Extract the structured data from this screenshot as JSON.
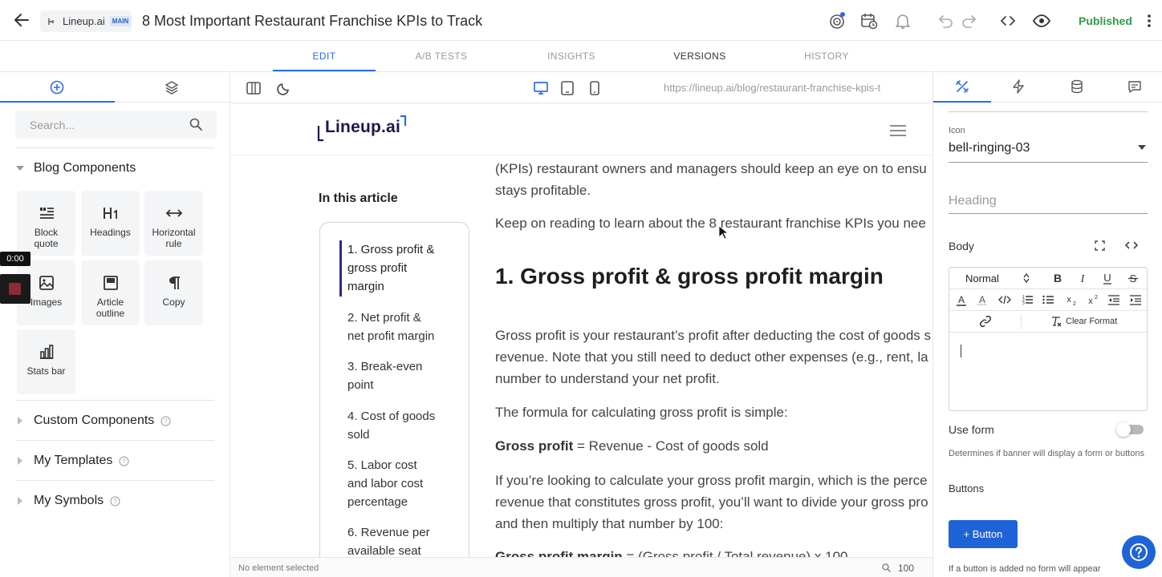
{
  "header": {
    "project_name": "Lineup.ai",
    "branch_badge": "MAIN",
    "doc_title": "8 Most Important Restaurant Franchise KPIs to Track",
    "status": "Published"
  },
  "tabs": [
    {
      "label": "EDIT"
    },
    {
      "label": "A/B TESTS"
    },
    {
      "label": "INSIGHTS"
    },
    {
      "label": "VERSIONS"
    },
    {
      "label": "HISTORY"
    }
  ],
  "left_panel": {
    "search_placeholder": "Search...",
    "blog_components_title": "Blog Components",
    "components": [
      {
        "label1": "Block",
        "label2": "quote",
        "icon": "block-quote-icon"
      },
      {
        "label1": "Headings",
        "label2": "",
        "icon": "heading-icon"
      },
      {
        "label1": "Horizontal",
        "label2": "rule",
        "icon": "horizontal-rule-icon"
      },
      {
        "label1": "Images",
        "label2": "",
        "icon": "image-icon"
      },
      {
        "label1": "Article",
        "label2": "outline",
        "icon": "outline-icon"
      },
      {
        "label1": "Copy",
        "label2": "",
        "icon": "paragraph-icon"
      },
      {
        "label1": "Stats bar",
        "label2": "",
        "icon": "bar-chart-icon"
      }
    ],
    "sections": [
      {
        "label": "Custom Components"
      },
      {
        "label": "My Templates"
      },
      {
        "label": "My Symbols"
      }
    ],
    "timer": "0:00"
  },
  "canvas": {
    "url": "https://lineup.ai/blog/restaurant-franchise-kpis-t",
    "logo": "Lineup.ai",
    "toc_title": "In this article",
    "toc": [
      {
        "line1": "1. Gross profit &",
        "line2": "gross profit",
        "line3": "margin"
      },
      {
        "line1": "2. Net profit &",
        "line2": "net profit margin",
        "line3": ""
      },
      {
        "line1": "3. Break-even",
        "line2": "point",
        "line3": ""
      },
      {
        "line1": "4. Cost of goods",
        "line2": "sold",
        "line3": ""
      },
      {
        "line1": "5. Labor cost",
        "line2": "and labor cost",
        "line3": "percentage"
      },
      {
        "line1": "6. Revenue per",
        "line2": "available seat",
        "line3": ""
      }
    ],
    "para_intro_1": "(KPIs) restaurant owners and managers should keep an eye on to ensu",
    "para_intro_2": "stays profitable.",
    "para_keep": "Keep on reading to learn about the 8 restaurant franchise KPIs you nee",
    "heading": "1. Gross profit & gross profit margin",
    "para_gp_1": "Gross profit is your restaurant’s profit after deducting the cost of goods s",
    "para_gp_2": "revenue. Note that you still need to deduct other expenses (e.g., rent, la",
    "para_gp_3": "number to understand your net profit.",
    "para_formula": "The formula for calculating gross profit is simple:",
    "formula_bold": "Gross profit",
    "formula_rest": " = Revenue - Cost of goods sold",
    "para_margin_1": "If you’re looking to calculate your gross profit margin, which is the perce",
    "para_margin_2": "revenue that constitutes gross profit, you’ll want to divide your gross pro",
    "para_margin_3": "and then multiply that number by 100:",
    "formula2_bold": "Gross profit margin",
    "formula2_rest": " = (Gross profit / Total revenue) x 100",
    "status_text": "No element selected",
    "zoom": "100"
  },
  "right_panel": {
    "icon_label": "Icon",
    "icon_value": "bell-ringing-03",
    "heading_placeholder": "Heading",
    "body_label": "Body",
    "format_select": "Normal",
    "clear_format": "Clear Format",
    "use_form_label": "Use form",
    "use_form_on": false,
    "use_form_desc": "Determines if banner will display a form or buttons",
    "buttons_label": "Buttons",
    "add_button": "+ Button",
    "footer_note": "If a button is added no form will appear"
  },
  "colors": {
    "accent": "#2b6de0",
    "published": "#2e9c45",
    "primary_button": "#1f63d8"
  }
}
